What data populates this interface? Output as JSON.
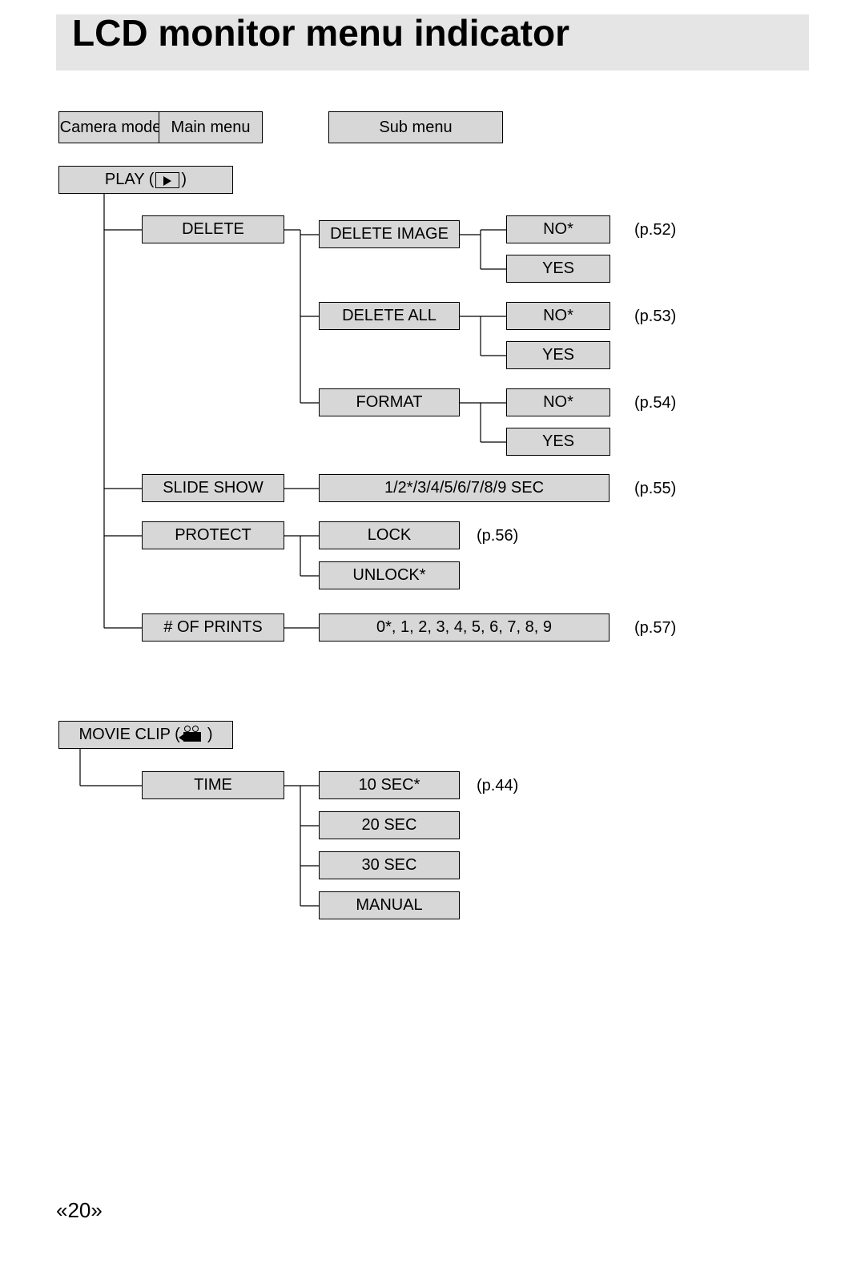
{
  "title": "LCD monitor menu indicator",
  "columns": {
    "camera_mode": "Camera mode",
    "main_menu": "Main menu",
    "sub_menu": "Sub menu"
  },
  "play": {
    "label_pre": "PLAY (",
    "label_post": " )",
    "delete": {
      "label": "DELETE",
      "delete_image": {
        "label": "DELETE IMAGE",
        "no": "NO*",
        "yes": "YES",
        "page": "(p.52)"
      },
      "delete_all": {
        "label": "DELETE ALL",
        "no": "NO*",
        "yes": "YES",
        "page": "(p.53)"
      },
      "format": {
        "label": "FORMAT",
        "no": "NO*",
        "yes": "YES",
        "page": "(p.54)"
      }
    },
    "slide_show": {
      "label": "SLIDE SHOW",
      "value": "1/2*/3/4/5/6/7/8/9 SEC",
      "page": "(p.55)"
    },
    "protect": {
      "label": "PROTECT",
      "lock": "LOCK",
      "unlock": "UNLOCK*",
      "page": "(p.56)"
    },
    "prints": {
      "label": "# OF PRINTS",
      "value": "0*, 1, 2, 3, 4, 5, 6, 7, 8, 9",
      "page": "(p.57)"
    }
  },
  "movie_clip": {
    "label_pre": "MOVIE CLIP (",
    "label_post": " )",
    "time": {
      "label": "TIME",
      "opts": [
        "10 SEC*",
        "20 SEC",
        "30 SEC",
        "MANUAL"
      ],
      "page": "(p.44)"
    }
  },
  "page_number": "20"
}
